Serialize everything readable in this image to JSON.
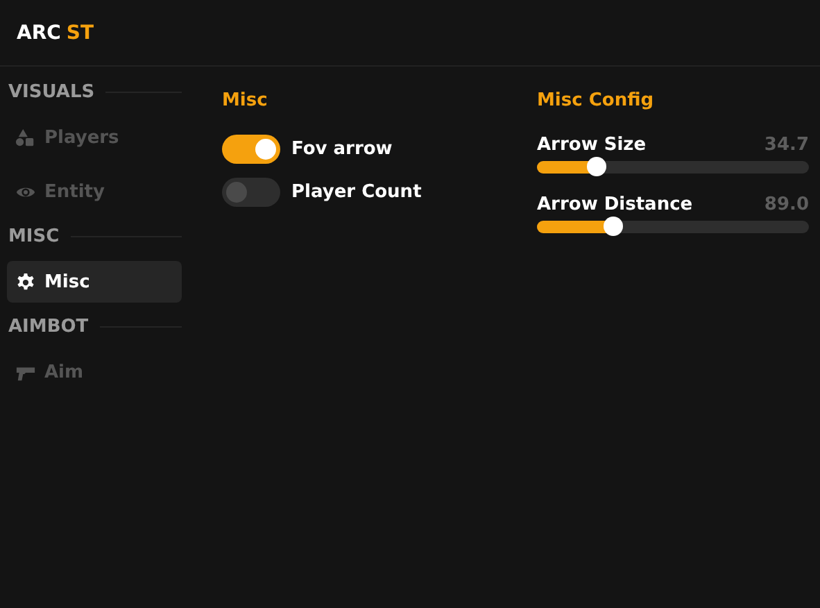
{
  "logo": {
    "text": "ARC",
    "accent": "ST"
  },
  "sidebar": {
    "sections": [
      {
        "title": "VISUALS",
        "items": [
          {
            "label": "Players",
            "kind": "shapes",
            "selected": false
          },
          {
            "label": "Entity",
            "kind": "eye",
            "selected": false
          }
        ]
      },
      {
        "title": "MISC",
        "items": [
          {
            "label": "Misc",
            "kind": "gear",
            "selected": true
          }
        ]
      },
      {
        "title": "AIMBOT",
        "items": [
          {
            "label": "Aim",
            "kind": "gun",
            "selected": false
          }
        ]
      }
    ]
  },
  "misc": {
    "title": "Misc",
    "toggles": [
      {
        "label": "Fov arrow",
        "on": true
      },
      {
        "label": "Player Count",
        "on": false
      }
    ]
  },
  "config": {
    "title": "Misc Config",
    "sliders": [
      {
        "label": "Arrow Size",
        "reading": "34.7",
        "level": 0.22
      },
      {
        "label": "Arrow Distance",
        "reading": "89.0",
        "level": 0.28
      }
    ]
  }
}
